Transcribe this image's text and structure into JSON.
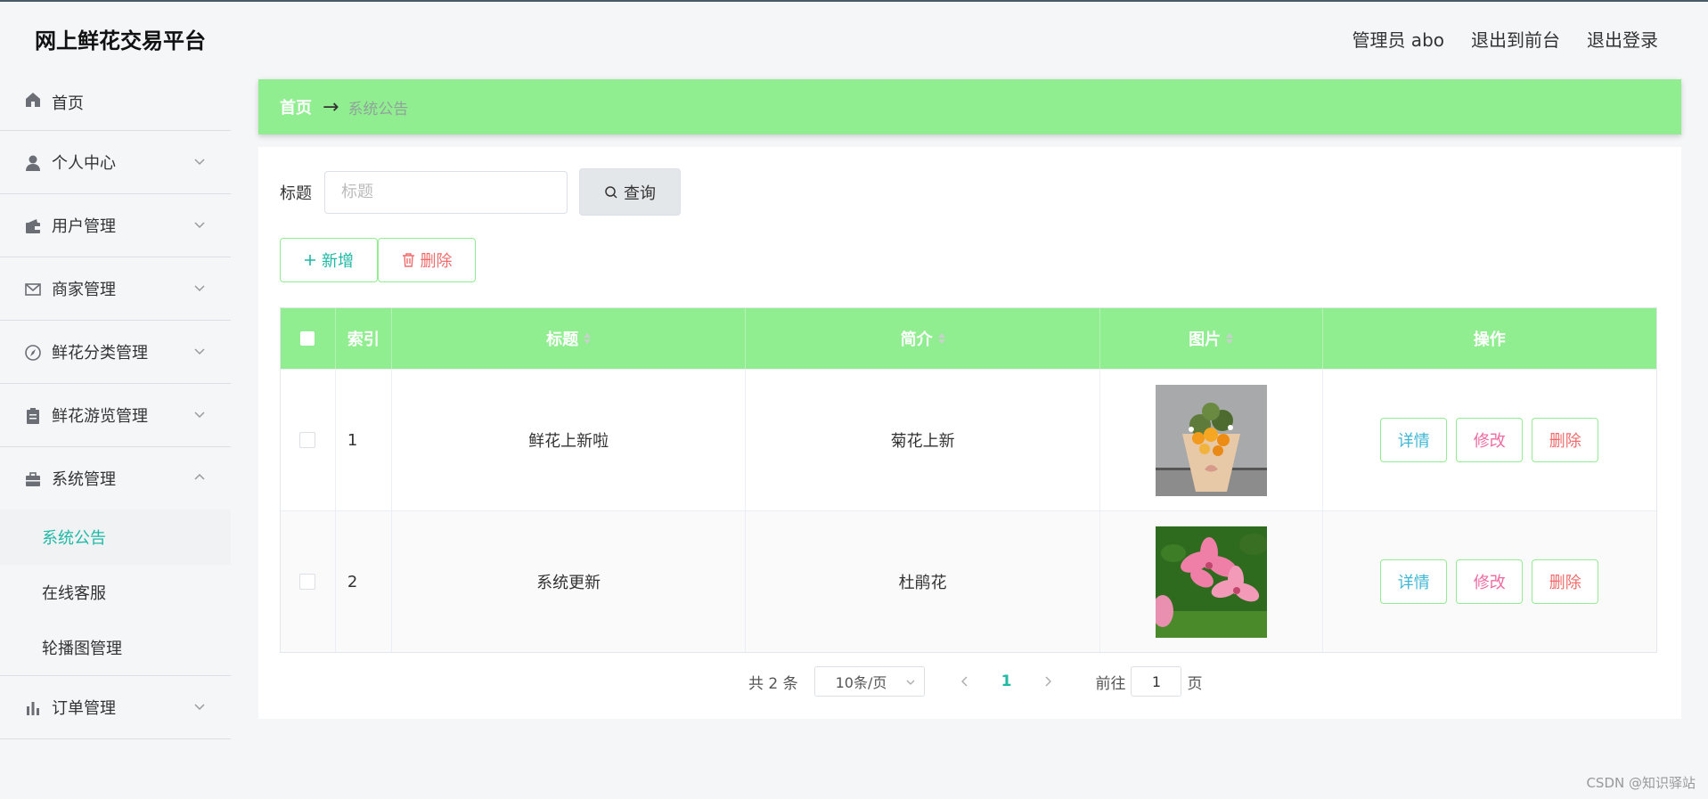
{
  "header": {
    "app_title": "网上鲜花交易平台",
    "admin_label": "管理员 abo",
    "exit_to_front": "退出到前台",
    "logout": "退出登录"
  },
  "sidebar": {
    "items": [
      {
        "label": "首页",
        "icon": "home-icon"
      },
      {
        "label": "个人中心",
        "icon": "user-icon"
      },
      {
        "label": "用户管理",
        "icon": "wallet-icon"
      },
      {
        "label": "商家管理",
        "icon": "mail-icon"
      },
      {
        "label": "鲜花分类管理",
        "icon": "compass-icon"
      },
      {
        "label": "鲜花游览管理",
        "icon": "clipboard-icon"
      },
      {
        "label": "系统管理",
        "icon": "briefcase-icon",
        "expanded": true
      },
      {
        "label": "订单管理",
        "icon": "bar-chart-icon"
      }
    ],
    "system_submenu": [
      {
        "label": "系统公告",
        "active": true
      },
      {
        "label": "在线客服"
      },
      {
        "label": "轮播图管理"
      }
    ]
  },
  "breadcrumb": {
    "home": "首页",
    "current": "系统公告"
  },
  "search": {
    "label": "标题",
    "placeholder": "标题",
    "value": "",
    "button": "查询"
  },
  "actions": {
    "add": "新增",
    "delete": "删除"
  },
  "table": {
    "columns": [
      "索引",
      "标题",
      "简介",
      "图片",
      "操作"
    ],
    "rows": [
      {
        "index": "1",
        "title": "鲜花上新啦",
        "intro": "菊花上新",
        "image": "bouquet-photo"
      },
      {
        "index": "2",
        "title": "系统更新",
        "intro": "杜鹃花",
        "image": "azalea-photo"
      }
    ],
    "row_buttons": {
      "detail": "详情",
      "edit": "修改",
      "delete": "删除"
    }
  },
  "pagination": {
    "total_text": "共 2 条",
    "page_size": "10条/页",
    "current_page": "1",
    "goto_label": "前往",
    "goto_value": "1",
    "page_suffix": "页"
  },
  "watermark": "CSDN @知识驿站",
  "colors": {
    "accent_green": "#90ee90",
    "teal": "#1fb9a5",
    "pink": "#ee6aa0",
    "red": "#f06b6b"
  }
}
